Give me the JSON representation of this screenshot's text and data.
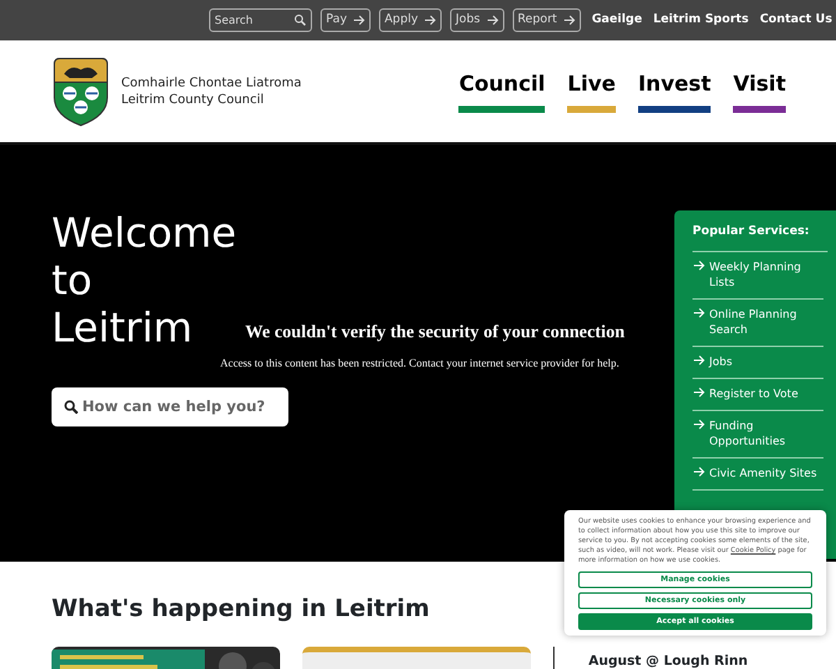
{
  "top_bar": {
    "search": {
      "placeholder": "Search"
    },
    "buttons": [
      "Pay",
      "Apply",
      "Jobs",
      "Report"
    ],
    "links": [
      "Gaeilge",
      "Leitrim Sports",
      "Contact Us"
    ]
  },
  "header": {
    "logo_lines": [
      "Comhairle Chontae Liatroma",
      "Leitrim County Council"
    ],
    "nav": [
      {
        "label": "Council",
        "color": "#0a8a4a"
      },
      {
        "label": "Live",
        "color": "#d9a93a"
      },
      {
        "label": "Invest",
        "color": "#123f82"
      },
      {
        "label": "Visit",
        "color": "#7b2d96"
      }
    ]
  },
  "hero": {
    "title": "Welcome to Leitrim",
    "search": {
      "placeholder": "How can we help you?"
    },
    "error": {
      "title": "We couldn't verify the security of your connection",
      "message": "Access to this content has been restricted. Contact your internet service provider for help."
    }
  },
  "popular_services": {
    "title": "Popular Services:",
    "items": [
      "Weekly Planning Lists",
      "Online Planning Search",
      "Jobs",
      "Register to Vote",
      "Funding Opportunities",
      "Civic Amenity Sites"
    ]
  },
  "whats_happening": {
    "title": "What's happening in Leitrim",
    "cards": [
      {
        "kind": "picture"
      },
      {
        "kind": "blank"
      },
      {
        "kind": "text",
        "title": "August @ Lough Rinn"
      }
    ]
  },
  "cookie_banner": {
    "text_before": "Our website uses cookies to enhance your browsing experience and to collect information about how you use this site to improve our service to you. By not accepting cookies some elements of the site, such as video, will not work. Please visit our",
    "link": "Cookie Policy",
    "text_after": "page for more information on how we use cookies.",
    "buttons": [
      {
        "label": "Manage cookies",
        "kind": "outline"
      },
      {
        "label": "Necessary cookies only",
        "kind": "outline"
      },
      {
        "label": "Accept all cookies",
        "kind": "solid"
      }
    ]
  }
}
